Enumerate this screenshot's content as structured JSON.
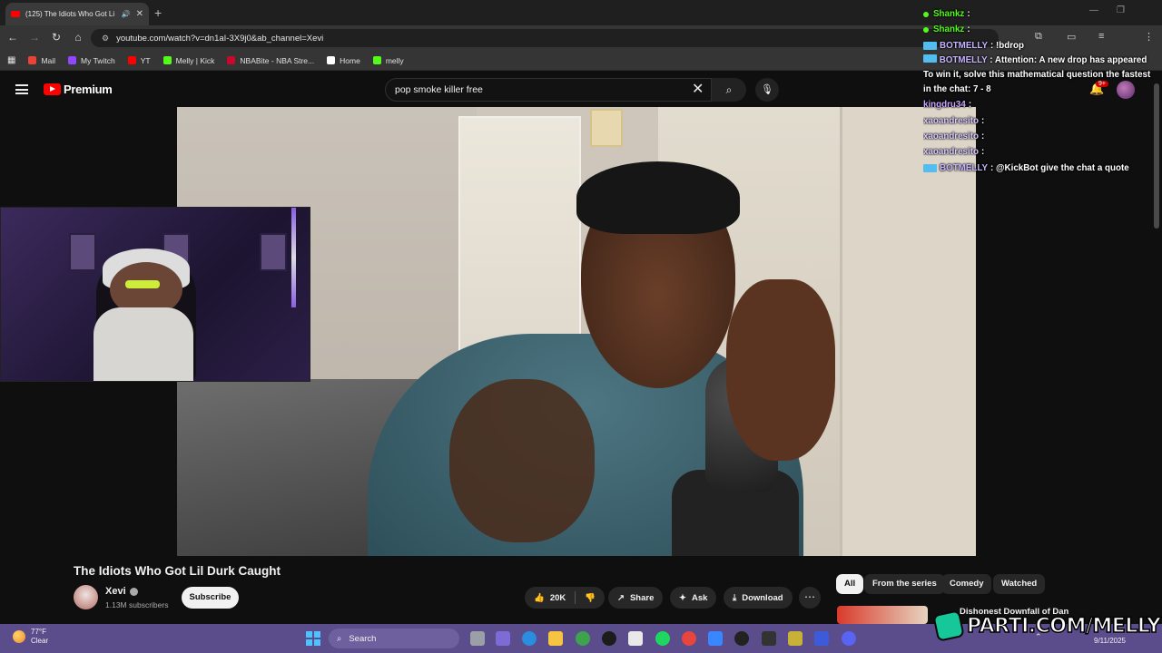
{
  "browser": {
    "tab_title": "(125) The Idiots Who Got Li",
    "tab_close": "✕",
    "new_tab": "+",
    "url": "youtube.com/watch?v=dn1aI-3X9j0&ab_channel=Xevi",
    "bookmarks": [
      {
        "label": "Mail",
        "color": "#ea4335"
      },
      {
        "label": "My Twitch",
        "color": "#9146ff"
      },
      {
        "label": "YT",
        "color": "#ff0000"
      },
      {
        "label": "Melly | Kick",
        "color": "#53fc18"
      },
      {
        "label": "NBABite - NBA Stre...",
        "color": "#c9082a"
      },
      {
        "label": "Home",
        "color": "#ffffff"
      },
      {
        "label": "melly",
        "color": "#53fc18"
      }
    ]
  },
  "youtube": {
    "brand": "Premium",
    "search_query": "pop smoke killer free",
    "notif_count": "9+",
    "video_title": "The Idiots Who Got Lil Durk Caught",
    "channel_name": "Xevi",
    "subscribers": "1.13M subscribers",
    "subscribe_label": "Subscribe",
    "like_count": "20K",
    "share_label": "Share",
    "ask_label": "Ask",
    "download_label": "Download",
    "chips": [
      "All",
      "From the series",
      "Comedy",
      "Watched"
    ],
    "related_title": "Dishonest Downfall of Dan"
  },
  "chat": {
    "messages": [
      {
        "user": "Shankz",
        "text": ":",
        "kind": "kick"
      },
      {
        "user": "Shankz",
        "text": ":",
        "kind": "kick"
      },
      {
        "user": "BOTMELLY",
        "text": ": !bdrop",
        "kind": "bot"
      },
      {
        "user": "BOTMELLY",
        "text": ": Attention: A new drop has appeared To win it, solve this mathematical question the fastest in the chat: 7 - 8",
        "kind": "bot-wrap"
      },
      {
        "user": "kingdru34",
        "text": ":",
        "kind": "purple"
      },
      {
        "user": "xaoandresito",
        "text": ":",
        "kind": "lav"
      },
      {
        "user": "xaoandresito",
        "text": ":",
        "kind": "lav"
      },
      {
        "user": "xaoandresito",
        "text": ":",
        "kind": "lav"
      },
      {
        "user": "BOTMELLY",
        "text": ": @KickBot give the chat a quote",
        "kind": "bot"
      }
    ]
  },
  "taskbar": {
    "temperature": "77°F",
    "condition": "Clear",
    "search_placeholder": "Search",
    "date": "9/11/2025"
  },
  "overlay": {
    "parti_text": "PARTI.COM/MELLY"
  },
  "colors": {
    "youtube_red": "#ff0000",
    "kick_green": "#53fc18",
    "taskbar_purple": "#5b4c8c",
    "bot_blue": "#53bdf0"
  }
}
